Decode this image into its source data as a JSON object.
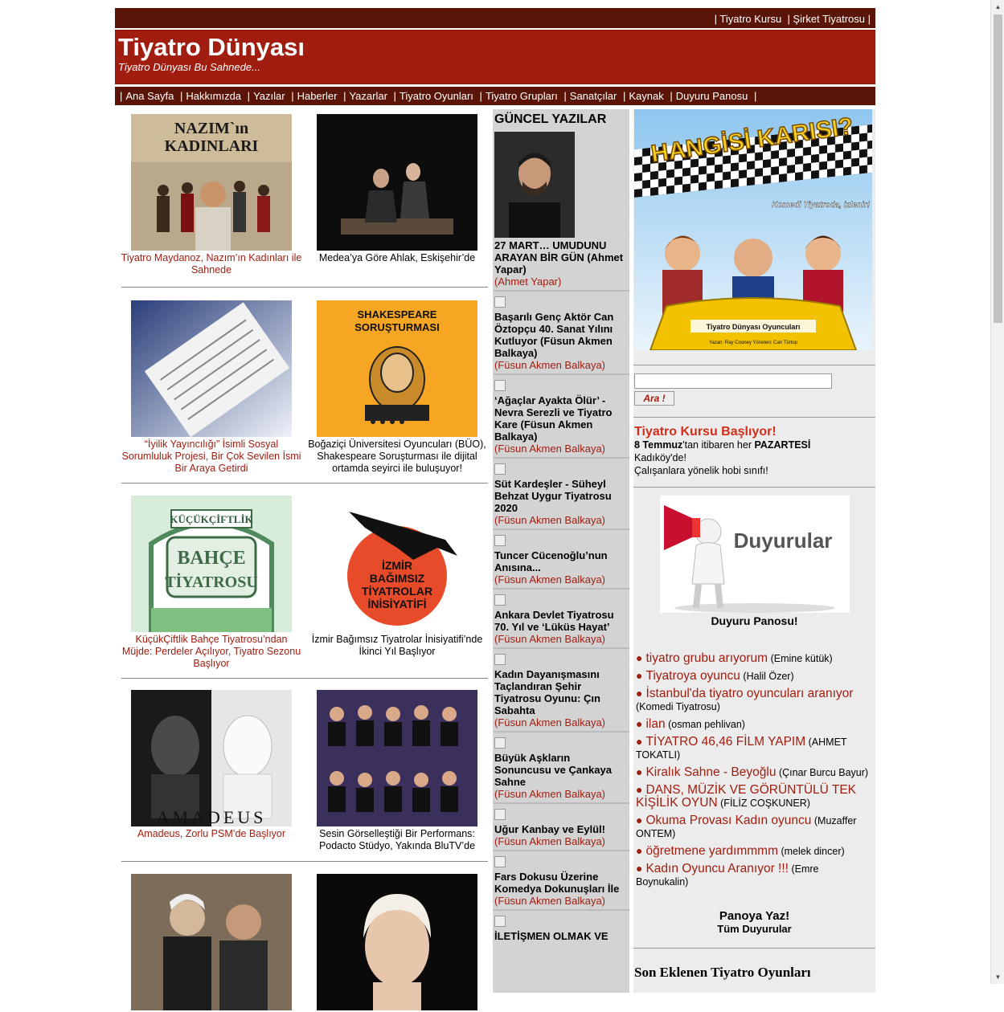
{
  "topbar": {
    "links": [
      "| Tiyatro Kursu",
      "| Şirket Tiyatrosu |"
    ]
  },
  "header": {
    "title": "Tiyatro Dünyası",
    "slogan": "Tiyatro Dünyası Bu Sahnede..."
  },
  "nav": {
    "items": [
      "Ana Sayfa",
      "Hakkımızda",
      "Yazılar",
      "Haberler",
      "Yazarlar",
      "Tiyatro Oyunları",
      "Tiyatro Grupları",
      "Sanatçılar",
      "Kaynak",
      "Duyuru Panosu"
    ]
  },
  "cards": [
    {
      "caption": "Tiyatro Maydanoz, Nazım’ın Kadınları ile Sahnede",
      "color": "red",
      "poster_text": "NAZIM`ın KADINLARI"
    },
    {
      "caption": "Medea’ya Göre Ahlak, Eskişehir’de",
      "color": "black"
    },
    {
      "caption": "“İyilik Yayıncılığı” İsimli Sosyal Sorumluluk Projesi, Bir Çok Sevilen İsmi Bir Araya Getirdi",
      "color": "red"
    },
    {
      "caption": "Boğaziçi Üniversitesi Oyuncuları (BÜO), Shakespeare Soruşturması ile dijital ortamda seyirci ile buluşuyor!",
      "color": "black",
      "poster_text": "SHAKESPEARE SORUŞTURMASI"
    },
    {
      "caption": "KüçükÇiftlik Bahçe Tiyatrosu’ndan Müjde: Perdeler Açılıyor, Tiyatro Sezonu Başlıyor",
      "color": "red",
      "poster_text": "BAHÇE TİYATROSU",
      "poster_top": "KÜÇÜKÇİFTLİK"
    },
    {
      "caption": "İzmir Bağımsız Tiyatrolar İnisiyatifi’nde İkinci Yıl Başlıyor",
      "color": "black",
      "poster_text": "İZMİR BAĞIMSIZ TİYATROLAR İNİSİYATİFİ"
    },
    {
      "caption": "Amadeus, Zorlu PSM’de Başlıyor",
      "color": "red",
      "poster_text": "AMADEUS"
    },
    {
      "caption": "Sesin Görselleştiği Bir Performans: Podacto Stüdyo, Yakında BluTV’de",
      "color": "black"
    },
    {
      "caption": "",
      "color": "red"
    },
    {
      "caption": "",
      "color": "black"
    }
  ],
  "guncel": {
    "title": "GÜNCEL YAZILAR",
    "articles": [
      {
        "title": "27 MART… UMUDUNU ARAYAN BİR GÜN (Ahmet Yapar)",
        "author": "(Ahmet Yapar)"
      },
      {
        "title": "Başarılı Genç Aktör Can Öztopçu 40. Sanat Yılını Kutluyor (Füsun Akmen Balkaya)",
        "author": "(Füsun Akmen Balkaya)"
      },
      {
        "title": "‘Ağaçlar Ayakta Ölür’ - Nevra Serezli ve Tiyatro Kare (Füsun Akmen Balkaya)",
        "author": "(Füsun Akmen Balkaya)"
      },
      {
        "title": "Süt Kardeşler - Süheyl Behzat Uygur Tiyatrosu 2020",
        "author": "(Füsun Akmen Balkaya)"
      },
      {
        "title": "Tuncer Cücenoğlu’nun Anısına...",
        "author": "(Füsun Akmen Balkaya)"
      },
      {
        "title": "Ankara Devlet Tiyatrosu 70. Yıl ve ‘Lüküs Hayat’",
        "author": "(Füsun Akmen Balkaya)"
      },
      {
        "title": "Kadın Dayanışmasını Taçlandıran Şehir Tiyatrosu Oyunu: Çın Sabahta",
        "author": "(Füsun Akmen Balkaya)"
      },
      {
        "title": "Büyük Aşkların Sonuncusu ve Çankaya Sahne",
        "author": "(Füsun Akmen Balkaya)"
      },
      {
        "title": "Uğur Kanbay ve Eylül!",
        "author": "(Füsun Akmen Balkaya)"
      },
      {
        "title": "Fars Dokusu Üzerine Komedya Dokunuşları İle",
        "author": "(Füsun Akmen Balkaya)"
      },
      {
        "title": "İLETİŞMEN OLMAK VE",
        "author": ""
      }
    ]
  },
  "banner": {
    "title": "HANGİSİ KARISI?",
    "subtitle": "Komedi Tiyatroda, izlenir!",
    "troupe": "Tiyatro Dünyası Oyuncuları",
    "credits": "Yazan: Ray Cooney  Yöneten: Can Türtop"
  },
  "search": {
    "button": "Ara !",
    "value": ""
  },
  "kurs": {
    "title": "Tiyatro Kursu Başlıyor!",
    "date_bold": "8 Temmuz",
    "date_rest": "'tan itibaren her ",
    "day": "PAZARTESİ",
    "place": "Kadıköy'de!",
    "desc": "Çalışanlara yönelik hobi sınıfı!"
  },
  "duyuru": {
    "image_text": "Duyurular",
    "title": "Duyuru Panosu!",
    "items": [
      {
        "title": "tiyatro grubu arıyorum",
        "user": "(Emine kütük)"
      },
      {
        "title": "Tiyatroya oyuncu",
        "user": "(Halil Özer)"
      },
      {
        "title": "İstanbul'da tiyatro oyuncuları aranıyor",
        "user": "(Komedi Tiyatrosu)"
      },
      {
        "title": "ilan",
        "user": "(osman pehlivan)"
      },
      {
        "title": "TİYATRO 46,46 FİLM YAPIM",
        "user": "(AHMET TOKATLI)"
      },
      {
        "title": "Kiralık Sahne - Beyoğlu",
        "user": "(Çınar Burcu Bayur)"
      },
      {
        "title": "DANS, MÜZİK VE GÖRÜNTÜLÜ TEK KİŞİLİK OYUN",
        "user": "(FİLİZ COŞKUNER)"
      },
      {
        "title": "Okuma Provası Kadın oyuncu",
        "user": "(Muzaffer ONTEM)"
      },
      {
        "title": "öğretmene yardımmmm",
        "user": "(melek dincer)"
      },
      {
        "title": "Kadın Oyuncu Aranıyor !!!",
        "user": "(Emre Boynukalin)"
      }
    ],
    "panoya": "Panoya Yaz!",
    "tum": "Tüm Duyurular"
  },
  "son": {
    "title": "Son Eklenen Tiyatro Oyunları"
  }
}
